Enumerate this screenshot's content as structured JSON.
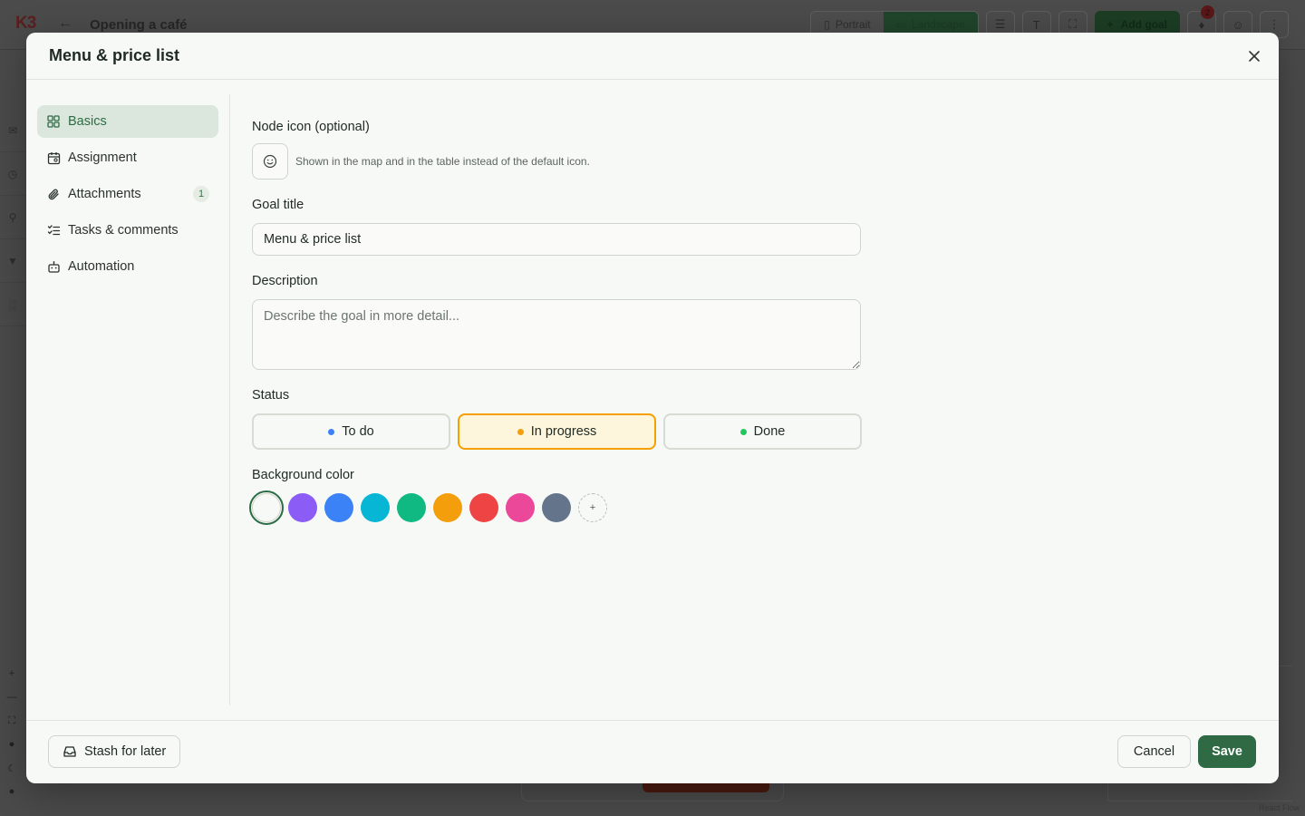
{
  "app": {
    "logo": "K3",
    "title": "Opening a café",
    "view_portrait": "Portrait",
    "view_landscape": "Landscape",
    "add_goal": "Add goal",
    "notifications_count": "2",
    "react_flow": "React Flow"
  },
  "modal": {
    "title": "Menu & price list",
    "nav": [
      {
        "label": "Basics",
        "icon": "grid-icon",
        "active": true
      },
      {
        "label": "Assignment",
        "icon": "calendar-user-icon"
      },
      {
        "label": "Attachments",
        "icon": "paperclip-icon",
        "count": "1"
      },
      {
        "label": "Tasks & comments",
        "icon": "checklist-icon"
      },
      {
        "label": "Automation",
        "icon": "robot-icon"
      }
    ],
    "form": {
      "node_icon_label": "Node icon (optional)",
      "node_icon_hint": "Shown in the map and in the table instead of the default icon.",
      "goal_title_label": "Goal title",
      "goal_title_value": "Menu & price list",
      "description_label": "Description",
      "description_placeholder": "Describe the goal in more detail...",
      "status_label": "Status",
      "statuses": [
        {
          "label": "To do",
          "color": "#3b82f6"
        },
        {
          "label": "In progress",
          "color": "#f59e0b",
          "selected": true
        },
        {
          "label": "Done",
          "color": "#22c55e"
        }
      ],
      "background_color_label": "Background color",
      "colors": [
        "#f7f9f6",
        "#8b5cf6",
        "#3b82f6",
        "#06b6d4",
        "#10b981",
        "#f59e0b",
        "#ef4444",
        "#ec4899",
        "#64748b"
      ],
      "selected_color": "#f7f9f6",
      "add_color": "+"
    },
    "footer": {
      "stash_label": "Stash for later",
      "cancel_label": "Cancel",
      "save_label": "Save"
    }
  }
}
